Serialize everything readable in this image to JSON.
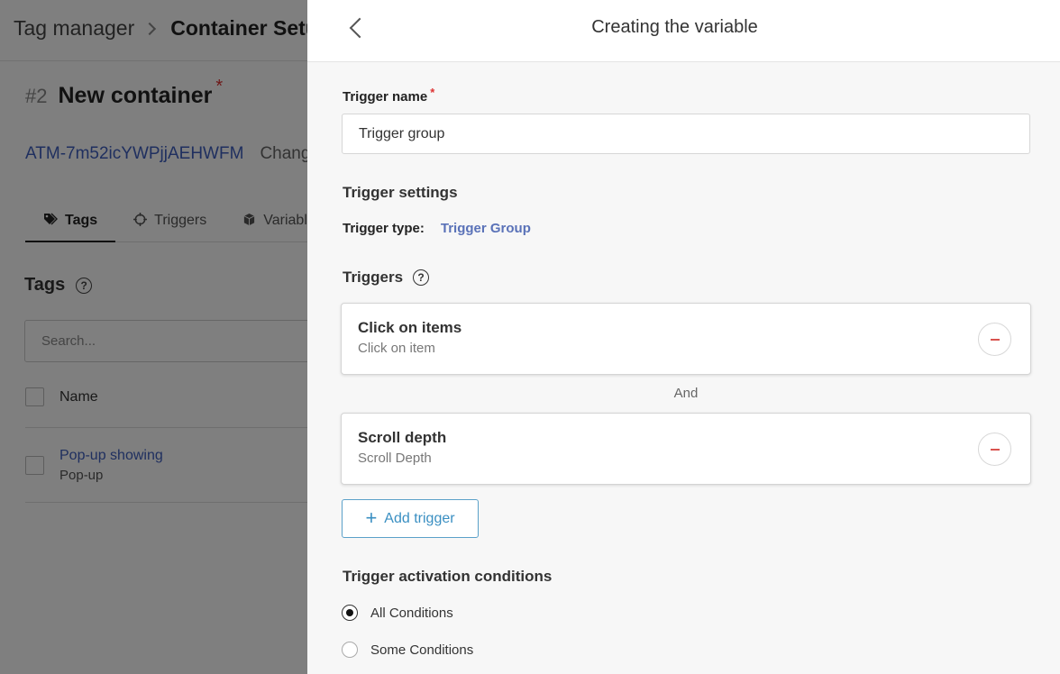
{
  "background": {
    "breadcrumb": {
      "root": "Tag manager",
      "current": "Container Setu"
    },
    "container": {
      "number": "#2",
      "name": "New container",
      "required_mark": "*"
    },
    "container_id": "ATM-7m52icYWPjjAEHWFM",
    "change_link": "Chang",
    "tabs": [
      {
        "label": "Tags",
        "icon": "tags-icon"
      },
      {
        "label": "Triggers",
        "icon": "crosshair-icon"
      },
      {
        "label": "Variabl",
        "icon": "cube-icon"
      }
    ],
    "tags_heading": "Tags",
    "help_glyph": "?",
    "search_placeholder": "Search...",
    "list": {
      "column_name": "Name",
      "rows": [
        {
          "title": "Pop-up showing",
          "subtitle": "Pop-up"
        }
      ]
    }
  },
  "drawer": {
    "title": "Creating the variable",
    "trigger_name": {
      "label": "Trigger name",
      "required_mark": "*",
      "value": "Trigger group"
    },
    "settings_title": "Trigger settings",
    "trigger_type": {
      "label": "Trigger type:",
      "value": "Trigger Group"
    },
    "triggers_heading": "Triggers",
    "help_glyph": "?",
    "triggers": [
      {
        "name": "Click on items",
        "type": "Click on item"
      },
      {
        "name": "Scroll depth",
        "type": "Scroll Depth"
      }
    ],
    "connector": "And",
    "add_trigger_label": "Add trigger",
    "activation": {
      "title": "Trigger activation conditions",
      "options": [
        {
          "label": "All Conditions",
          "selected": true
        },
        {
          "label": "Some Conditions",
          "selected": false
        }
      ]
    }
  },
  "colors": {
    "accent_link": "#3f5fbf",
    "trigger_type_value": "#5a72b8",
    "add_button": "#3a8fc2",
    "remove_icon": "#d9534f",
    "required": "#dd3333"
  }
}
